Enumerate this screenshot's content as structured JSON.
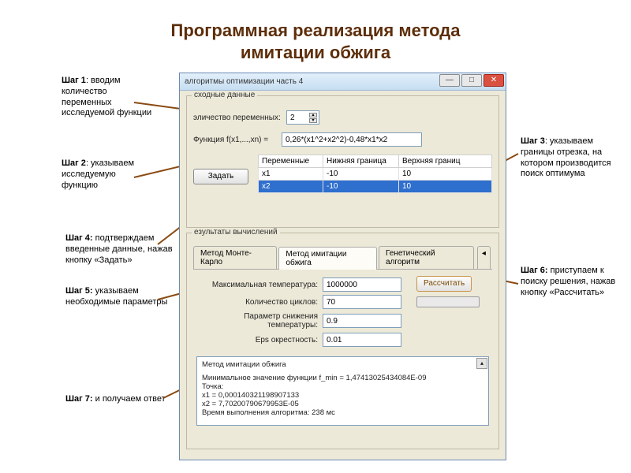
{
  "title_line1": "Программная реализация метода",
  "title_line2": "имитации обжига",
  "annotations": {
    "step1": {
      "label": "Шаг 1",
      "text": ": вводим количество переменных исследуемой функции"
    },
    "step2": {
      "label": "Шаг 2",
      "text": ": указываем исследуемую функцию"
    },
    "step3": {
      "label": "Шаг 3",
      "text": ": указываем границы отрезка, на котором производится поиск оптимума"
    },
    "step4": {
      "label": "Шаг 4:",
      "text": " подтверждаем введенные данные, нажав кнопку «Задать»"
    },
    "step5": {
      "label": "Шаг 5:",
      "text": "  указываем необходимые параметры"
    },
    "step6": {
      "label": "Шаг 6:",
      "text": " приступаем к поиску решения, нажав кнопку «Рассчитать»"
    },
    "step7": {
      "label": "Шаг 7:",
      "text": "  и получаем ответ"
    }
  },
  "window": {
    "title": "алгоритмы оптимизации часть 4",
    "groups": {
      "input": {
        "legend": "сходные данные",
        "vars_label": "эличество переменных:",
        "vars_value": "2",
        "func_label": "Функция f(x1,...,xn) =",
        "func_value": "0,26*(x1^2+x2^2)-0,48*x1*x2",
        "set_button": "Задать",
        "table": {
          "headers": [
            "Переменные",
            "Нижняя граница",
            "Верхняя границ"
          ],
          "rows": [
            {
              "var": "x1",
              "low": "-10",
              "high": "10",
              "selected": false
            },
            {
              "var": "x2",
              "low": "-10",
              "high": "10",
              "selected": true
            }
          ]
        }
      },
      "results": {
        "legend": "езультаты вычислений",
        "tabs": [
          "Метод Монте-Карло",
          "Метод имитации обжига",
          "Генетический алгоритм"
        ],
        "active_tab": 1,
        "params": {
          "max_temp_label": "Максимальная температура:",
          "max_temp_value": "1000000",
          "cycles_label": "Количество циклов:",
          "cycles_value": "70",
          "cool_label": "Параметр снижения температуры:",
          "cool_value": "0.9",
          "eps_label": "Eps окрестность:",
          "eps_value": "0.01",
          "calc_button": "Рассчитать"
        },
        "output": {
          "l1": "Метод имитации обжига",
          "l2": "Минимальное значение функции f_min = 1,47413025434084E-09",
          "l3": "Точка:",
          "l4": "x1 = 0,000140321198907133",
          "l5": "x2 = 7,70200790679953E-05",
          "l6": "Время выполнения алгоритма: 238 мс"
        }
      }
    }
  }
}
